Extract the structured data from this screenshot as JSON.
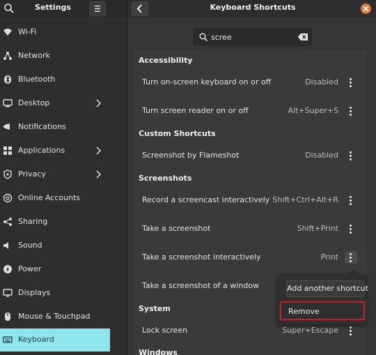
{
  "left_header": {
    "title": "Settings"
  },
  "sidebar": {
    "items": [
      {
        "label": "Wi-Fi",
        "icon": "wifi-icon"
      },
      {
        "label": "Network",
        "icon": "network-icon"
      },
      {
        "label": "Bluetooth",
        "icon": "bluetooth-icon"
      },
      {
        "label": "Desktop",
        "icon": "desktop-icon",
        "has_arrow": true
      },
      {
        "label": "Notifications",
        "icon": "notifications-icon"
      },
      {
        "label": "Applications",
        "icon": "applications-icon",
        "has_arrow": true
      },
      {
        "label": "Privacy",
        "icon": "privacy-icon",
        "has_arrow": true
      },
      {
        "label": "Online Accounts",
        "icon": "online-accounts-icon"
      },
      {
        "label": "Sharing",
        "icon": "sharing-icon"
      },
      {
        "label": "Sound",
        "icon": "sound-icon"
      },
      {
        "label": "Power",
        "icon": "power-icon"
      },
      {
        "label": "Displays",
        "icon": "displays-icon"
      },
      {
        "label": "Mouse & Touchpad",
        "icon": "mouse-icon"
      },
      {
        "label": "Keyboard",
        "icon": "keyboard-icon",
        "selected": true
      }
    ]
  },
  "right_header": {
    "title": "Keyboard Shortcuts"
  },
  "search": {
    "value": "scree"
  },
  "sections": {
    "accessibility": "Accessibility",
    "custom": "Custom Shortcuts",
    "screenshots": "Screenshots",
    "system": "System",
    "windows": "Windows"
  },
  "shortcuts": [
    {
      "name": "Turn on-screen keyboard on or off",
      "accel": "Disabled"
    },
    {
      "name": "Turn screen reader on or off",
      "accel": "Alt+Super+S"
    },
    {
      "name": "Screenshot by Flameshot",
      "accel": "Disabled"
    },
    {
      "name": "Record a screencast interactively",
      "accel": "Shift+Ctrl+Alt+R"
    },
    {
      "name": "Take a screenshot",
      "accel": "Shift+Print"
    },
    {
      "name": "Take a screenshot interactively",
      "accel": "Print"
    },
    {
      "name": "Take a screenshot of a window",
      "accel": ""
    },
    {
      "name": "Lock screen",
      "accel": "Super+Escape"
    }
  ],
  "popover": {
    "add_label": "Add another shortcut",
    "remove_label": "Remove"
  },
  "colors": {
    "selected_bg": "#8ee5ec",
    "highlight_border": "#c8202a",
    "close_button": "#e0793a"
  }
}
